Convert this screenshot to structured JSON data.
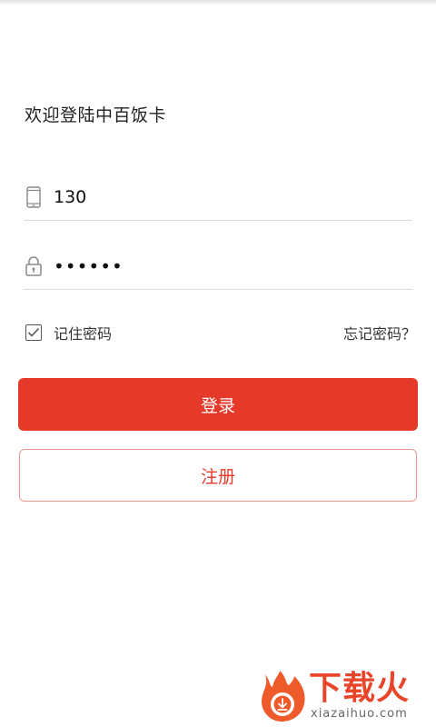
{
  "header": {
    "welcome_text": "欢迎登陆中百饭卡"
  },
  "form": {
    "phone": {
      "value": "130",
      "icon": "phone-icon"
    },
    "password": {
      "value": "••••••",
      "icon": "lock-icon"
    },
    "remember": {
      "label": "记住密码",
      "checked": true
    },
    "forgot_label": "忘记密码？"
  },
  "actions": {
    "login_label": "登录",
    "register_label": "注册"
  },
  "watermark": {
    "title": "下载火",
    "url": "xiazaihuo.com"
  },
  "colors": {
    "accent": "#e53a2a",
    "register_border": "#ef9a8f",
    "divider": "#dcdcdc"
  }
}
